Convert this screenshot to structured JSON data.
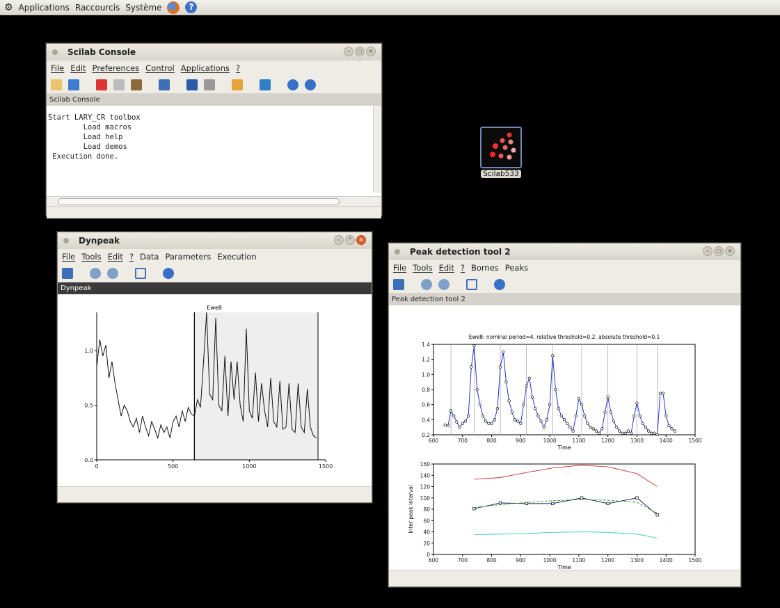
{
  "topbar": {
    "items": [
      "Applications",
      "Raccourcis",
      "Système"
    ]
  },
  "desktop_icon": {
    "label": "Scilab533"
  },
  "console_win": {
    "title": "Scilab Console",
    "menu": [
      "File",
      "Edit",
      "Preferences",
      "Control",
      "Applications",
      "?"
    ],
    "panel_label": "Scilab Console",
    "lines": [
      "Start LARY_CR toolbox",
      "        Load macros",
      "        Load help",
      "        Load demos",
      "",
      "",
      " Execution done."
    ]
  },
  "dynpeak_win": {
    "title": "Dynpeak",
    "menu": [
      "File",
      "Tools",
      "Edit",
      "?",
      "Data",
      "Parameters",
      "Execution"
    ],
    "panel_label": "Dynpeak",
    "plot_title": "Ewe8",
    "x_ticks": [
      "0",
      "500",
      "1000",
      "1500"
    ],
    "y_ticks": [
      "0.0",
      "0.5",
      "1.0"
    ]
  },
  "peak_win": {
    "title": "Peak detection tool 2",
    "menu": [
      "File",
      "Tools",
      "Edit",
      "?",
      "Bornes",
      "Peaks"
    ],
    "panel_label": "Peak detection tool 2",
    "plot1_title": "Ewe8: nominal period=4, relative threshold=0.2, absolute threshold=0.1",
    "plot1_xlabel": "Time",
    "plot1_x_ticks": [
      "600",
      "700",
      "800",
      "900",
      "1000",
      "1100",
      "1200",
      "1300",
      "1400",
      "1500"
    ],
    "plot1_y_ticks": [
      "0.2",
      "0.4",
      "0.6",
      "0.8",
      "1.0",
      "1.2",
      "1.4"
    ],
    "plot2_xlabel": "Time",
    "plot2_ylabel": "Inter peak interval",
    "plot2_x_ticks": [
      "600",
      "700",
      "800",
      "900",
      "1000",
      "1100",
      "1200",
      "1300",
      "1400",
      "1500"
    ],
    "plot2_y_ticks": [
      "0",
      "20",
      "40",
      "60",
      "80",
      "100",
      "120",
      "140",
      "160"
    ]
  },
  "chart_data": [
    {
      "type": "line",
      "title": "Ewe8",
      "xlim": [
        0,
        1500
      ],
      "ylim": [
        0,
        1.35
      ],
      "shaded_range": [
        640,
        1450
      ],
      "x": [
        0,
        20,
        40,
        60,
        80,
        100,
        120,
        140,
        160,
        180,
        200,
        220,
        240,
        260,
        280,
        300,
        320,
        340,
        360,
        380,
        400,
        420,
        440,
        460,
        480,
        500,
        520,
        540,
        560,
        580,
        600,
        620,
        640,
        660,
        680,
        700,
        720,
        740,
        760,
        780,
        800,
        820,
        840,
        860,
        880,
        900,
        920,
        940,
        960,
        980,
        1000,
        1020,
        1040,
        1060,
        1080,
        1100,
        1120,
        1140,
        1160,
        1180,
        1200,
        1220,
        1240,
        1260,
        1280,
        1300,
        1320,
        1340,
        1360,
        1380,
        1400,
        1420,
        1440
      ],
      "values": [
        0.85,
        1.1,
        0.95,
        1.05,
        0.75,
        0.9,
        0.7,
        0.55,
        0.4,
        0.5,
        0.45,
        0.35,
        0.3,
        0.38,
        0.25,
        0.4,
        0.3,
        0.22,
        0.35,
        0.28,
        0.2,
        0.32,
        0.25,
        0.3,
        0.2,
        0.35,
        0.4,
        0.3,
        0.45,
        0.35,
        0.48,
        0.42,
        0.4,
        0.55,
        0.48,
        0.9,
        1.35,
        0.6,
        0.55,
        1.3,
        0.5,
        0.45,
        0.95,
        0.4,
        0.9,
        0.55,
        0.9,
        0.5,
        0.35,
        1.2,
        0.45,
        0.38,
        0.8,
        0.35,
        0.7,
        0.45,
        0.3,
        0.75,
        0.35,
        0.3,
        0.72,
        0.28,
        0.3,
        0.7,
        0.28,
        0.25,
        0.7,
        0.3,
        0.25,
        0.65,
        0.3,
        0.22,
        0.2
      ]
    },
    {
      "type": "line",
      "title": "Ewe8: nominal period=4, relative threshold=0.2, absolute threshold=0.1",
      "xlabel": "Time",
      "xlim": [
        600,
        1500
      ],
      "ylim": [
        0.2,
        1.4
      ],
      "x": [
        640,
        650,
        660,
        670,
        680,
        690,
        700,
        710,
        720,
        730,
        740,
        750,
        760,
        770,
        780,
        790,
        800,
        810,
        820,
        830,
        840,
        850,
        860,
        870,
        880,
        890,
        900,
        910,
        920,
        930,
        940,
        950,
        960,
        970,
        980,
        990,
        1000,
        1010,
        1020,
        1030,
        1040,
        1050,
        1060,
        1070,
        1080,
        1090,
        1100,
        1110,
        1120,
        1130,
        1140,
        1150,
        1160,
        1170,
        1180,
        1190,
        1200,
        1210,
        1220,
        1230,
        1240,
        1250,
        1260,
        1270,
        1280,
        1290,
        1300,
        1310,
        1320,
        1330,
        1340,
        1350,
        1360,
        1370,
        1380,
        1390,
        1400,
        1410,
        1420,
        1430
      ],
      "values": [
        0.33,
        0.32,
        0.52,
        0.45,
        0.37,
        0.3,
        0.35,
        0.38,
        0.45,
        1.1,
        1.38,
        0.8,
        0.6,
        0.45,
        0.38,
        0.35,
        0.35,
        0.4,
        0.55,
        1.1,
        1.3,
        0.9,
        0.65,
        0.5,
        0.4,
        0.38,
        0.35,
        0.6,
        0.85,
        0.95,
        0.7,
        0.55,
        0.45,
        0.38,
        0.3,
        0.4,
        0.6,
        1.25,
        0.8,
        0.55,
        0.45,
        0.4,
        0.35,
        0.3,
        0.25,
        0.45,
        0.68,
        0.6,
        0.45,
        0.35,
        0.3,
        0.28,
        0.25,
        0.22,
        0.28,
        0.5,
        0.7,
        0.5,
        0.38,
        0.3,
        0.25,
        0.22,
        0.22,
        0.25,
        0.22,
        0.45,
        0.62,
        0.45,
        0.35,
        0.3,
        0.25,
        0.22,
        0.22,
        0.2,
        0.75,
        0.75,
        0.45,
        0.32,
        0.28,
        0.25
      ],
      "peaks_x": [
        660,
        740,
        830,
        920,
        1010,
        1110,
        1200,
        1300,
        1370
      ]
    },
    {
      "type": "line",
      "xlabel": "Time",
      "ylabel": "Inter peak interval",
      "xlim": [
        600,
        1500
      ],
      "ylim": [
        0,
        160
      ],
      "series": [
        {
          "color": "#cc3333",
          "x": [
            740,
            830,
            920,
            1010,
            1110,
            1200,
            1300,
            1370
          ],
          "values": [
            133,
            136,
            145,
            153,
            158,
            155,
            143,
            120
          ]
        },
        {
          "color": "#1a1a66",
          "x": [
            740,
            830,
            920,
            1010,
            1110,
            1200,
            1300,
            1370
          ],
          "values": [
            81,
            91,
            90,
            90,
            100,
            90,
            100,
            70
          ]
        },
        {
          "color": "#33aa33",
          "x": [
            740,
            830,
            920,
            1010,
            1110,
            1200,
            1300,
            1370
          ],
          "values": [
            83,
            88,
            92,
            95,
            97,
            96,
            92,
            73
          ]
        },
        {
          "color": "#33cccc",
          "x": [
            740,
            830,
            920,
            1010,
            1110,
            1200,
            1300,
            1370
          ],
          "values": [
            35,
            36,
            37,
            39,
            40,
            39,
            36,
            29
          ]
        }
      ]
    }
  ]
}
